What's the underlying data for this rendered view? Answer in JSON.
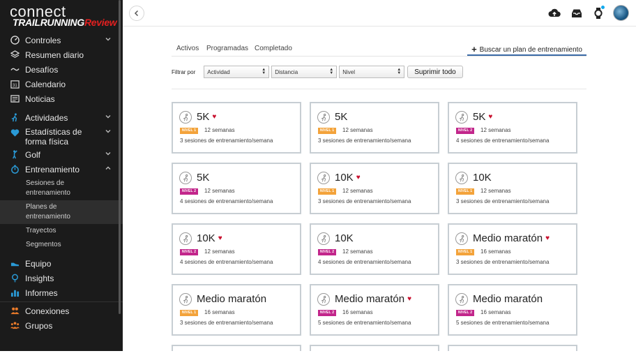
{
  "brand": {
    "connect": "connect",
    "overlay_main": "TRAILRUNNING",
    "overlay_accent": "Review"
  },
  "sidebar": {
    "items": [
      {
        "label": "Controles",
        "icon": "gauge-icon",
        "chevron": "down"
      },
      {
        "label": "Resumen diario",
        "icon": "layers-icon"
      },
      {
        "label": "Desafíos",
        "icon": "wave-icon"
      },
      {
        "label": "Calendario",
        "icon": "calendar-icon",
        "icon_text": "31"
      },
      {
        "label": "Noticias",
        "icon": "news-icon"
      },
      {
        "label": "Actividades",
        "icon": "runner-icon",
        "chevron": "down"
      },
      {
        "label": "Estadísticas de forma física",
        "icon": "heart-icon",
        "chevron": "down"
      },
      {
        "label": "Golf",
        "icon": "golfer-icon",
        "chevron": "down"
      },
      {
        "label": "Entrenamiento",
        "icon": "stopwatch-icon",
        "chevron": "up"
      },
      {
        "label": "Equipo",
        "icon": "shoe-icon"
      },
      {
        "label": "Insights",
        "icon": "lightbulb-icon"
      },
      {
        "label": "Informes",
        "icon": "bar-chart-icon"
      },
      {
        "label": "Conexiones",
        "icon": "people-icon"
      },
      {
        "label": "Grupos",
        "icon": "group-icon"
      }
    ],
    "training_sub": [
      {
        "label": "Sesiones de entrenamiento"
      },
      {
        "label": "Planes de entrenamiento",
        "active": true
      },
      {
        "label": "Trayectos"
      },
      {
        "label": "Segmentos"
      }
    ]
  },
  "tabs": [
    {
      "label": "Activos"
    },
    {
      "label": "Programadas"
    },
    {
      "label": "Completado"
    }
  ],
  "find_plan_label": "Buscar un plan de entrenamiento",
  "filters": {
    "label": "Filtrar por",
    "activity": "Actividad",
    "distance": "Distancia",
    "level": "Nivel",
    "clear_button": "Suprimir todo"
  },
  "colors": {
    "level1": "#f3a33b",
    "level2": "#c2268b",
    "heart": "#c8102e",
    "tab_underline": "#3a6aa6"
  },
  "plans": [
    {
      "title": "5K",
      "fav": true,
      "level": "NIVEL 1",
      "lvl": 1,
      "weeks": "12 semanas",
      "sessions": "3 sesiones de entrenamiento/semana"
    },
    {
      "title": "5K",
      "fav": false,
      "level": "NIVEL 1",
      "lvl": 1,
      "weeks": "12 semanas",
      "sessions": "3 sesiones de entrenamiento/semana"
    },
    {
      "title": "5K",
      "fav": true,
      "level": "NIVEL 2",
      "lvl": 2,
      "weeks": "12 semanas",
      "sessions": "4 sesiones de entrenamiento/semana"
    },
    {
      "title": "5K",
      "fav": false,
      "level": "NIVEL 2",
      "lvl": 2,
      "weeks": "12 semanas",
      "sessions": "4 sesiones de entrenamiento/semana"
    },
    {
      "title": "10K",
      "fav": true,
      "level": "NIVEL 1",
      "lvl": 1,
      "weeks": "12 semanas",
      "sessions": "3 sesiones de entrenamiento/semana"
    },
    {
      "title": "10K",
      "fav": false,
      "level": "NIVEL 1",
      "lvl": 1,
      "weeks": "12 semanas",
      "sessions": "3 sesiones de entrenamiento/semana"
    },
    {
      "title": "10K",
      "fav": true,
      "level": "NIVEL 2",
      "lvl": 2,
      "weeks": "12 semanas",
      "sessions": "4 sesiones de entrenamiento/semana"
    },
    {
      "title": "10K",
      "fav": false,
      "level": "NIVEL 2",
      "lvl": 2,
      "weeks": "12 semanas",
      "sessions": "4 sesiones de entrenamiento/semana"
    },
    {
      "title": "Medio maratón",
      "fav": true,
      "level": "NIVEL 1",
      "lvl": 1,
      "weeks": "16 semanas",
      "sessions": "3 sesiones de entrenamiento/semana"
    },
    {
      "title": "Medio maratón",
      "fav": false,
      "level": "NIVEL 1",
      "lvl": 1,
      "weeks": "16 semanas",
      "sessions": "3 sesiones de entrenamiento/semana"
    },
    {
      "title": "Medio maratón",
      "fav": true,
      "level": "NIVEL 2",
      "lvl": 2,
      "weeks": "16 semanas",
      "sessions": "5 sesiones de entrenamiento/semana"
    },
    {
      "title": "Medio maratón",
      "fav": false,
      "level": "NIVEL 2",
      "lvl": 2,
      "weeks": "16 semanas",
      "sessions": "5 sesiones de entrenamiento/semana"
    }
  ]
}
